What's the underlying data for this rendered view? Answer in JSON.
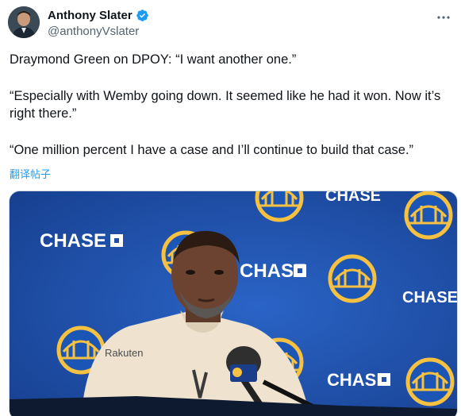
{
  "author": {
    "display_name": "Anthony Slater",
    "handle": "@anthonyVslater",
    "verified": true,
    "avatar": "profile-photo"
  },
  "tweet": {
    "paragraphs": [
      "Draymond Green on DPOY: “I want another one.”",
      "“Especially with Wemby going down. It seemed like he had it won. Now it’s right there.”",
      "“One million percent I have a case and I’ll continue to build that case.”"
    ],
    "translate_label": "翻译帖子"
  },
  "media": {
    "backdrop_sponsor": "CHASE",
    "backdrop_team_logo": "GOLDEN STATE WARRIORS",
    "shirt_brand": "Rakuten",
    "colors": {
      "backdrop_blue": "#1f4fa8",
      "warriors_gold": "#f6c141"
    }
  },
  "icons": {
    "verified": "verified-badge-icon",
    "more": "more-options-icon"
  },
  "colors": {
    "link": "#1d9bf0",
    "secondary_text": "#536471",
    "primary_text": "#0f1419",
    "verified": "#1d9bf0"
  }
}
